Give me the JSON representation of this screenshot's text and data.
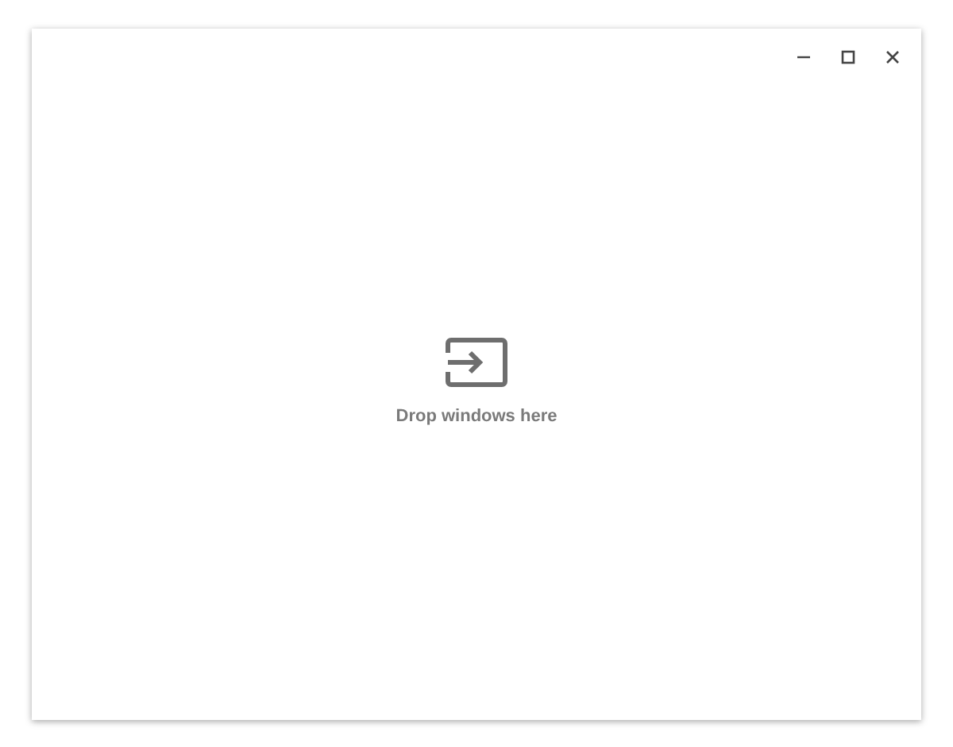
{
  "drop_zone": {
    "message": "Drop windows here"
  }
}
